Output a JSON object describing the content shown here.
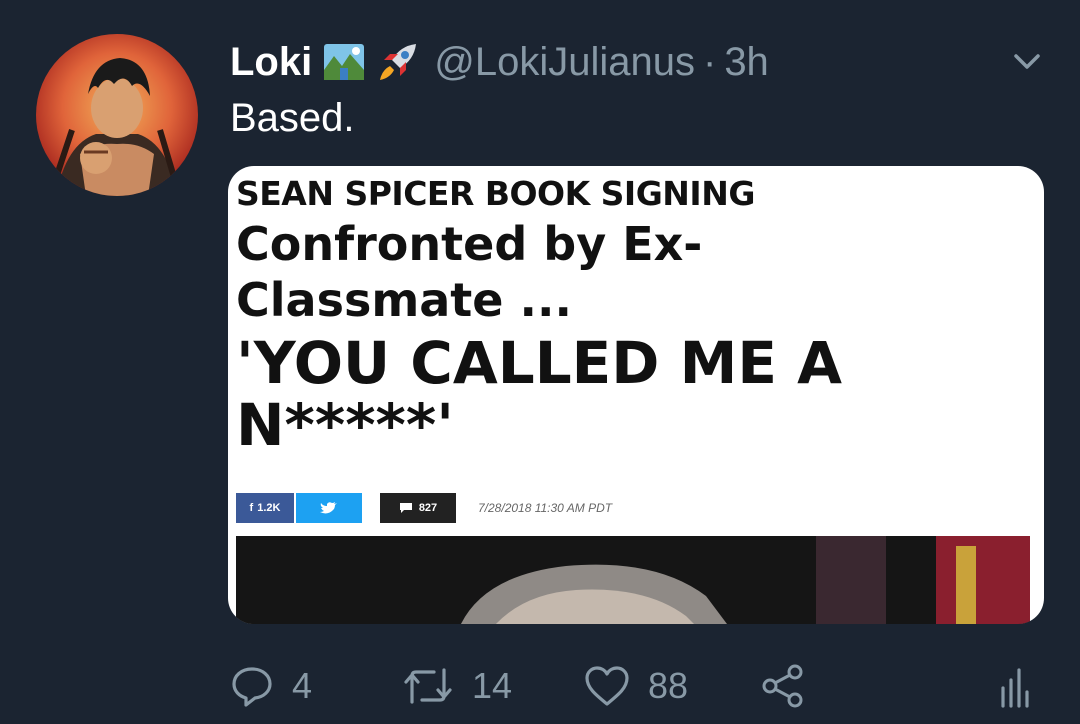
{
  "tweet": {
    "display_name": "Loki",
    "handle": "@LokiJulianus",
    "separator": "·",
    "timestamp": "3h",
    "text": "Based.",
    "name_emojis": [
      "national-park-emoji",
      "rocket-emoji"
    ]
  },
  "media": {
    "kicker": "SEAN SPICER BOOK SIGNING",
    "headline_line1": "Confronted by Ex-",
    "headline_line2": "Classmate ...",
    "headline_line3": "'YOU CALLED ME A",
    "headline_line4": "N*****'",
    "fb_count": "1.2K",
    "comment_count": "827",
    "date_stamp": "7/28/2018 11:30 AM PDT"
  },
  "actions": {
    "reply_count": "4",
    "retweet_count": "14",
    "like_count": "88"
  },
  "colors": {
    "background": "#1b2431",
    "secondary_text": "#8899a6",
    "facebook": "#3b5998",
    "twitter": "#1da1f2"
  }
}
